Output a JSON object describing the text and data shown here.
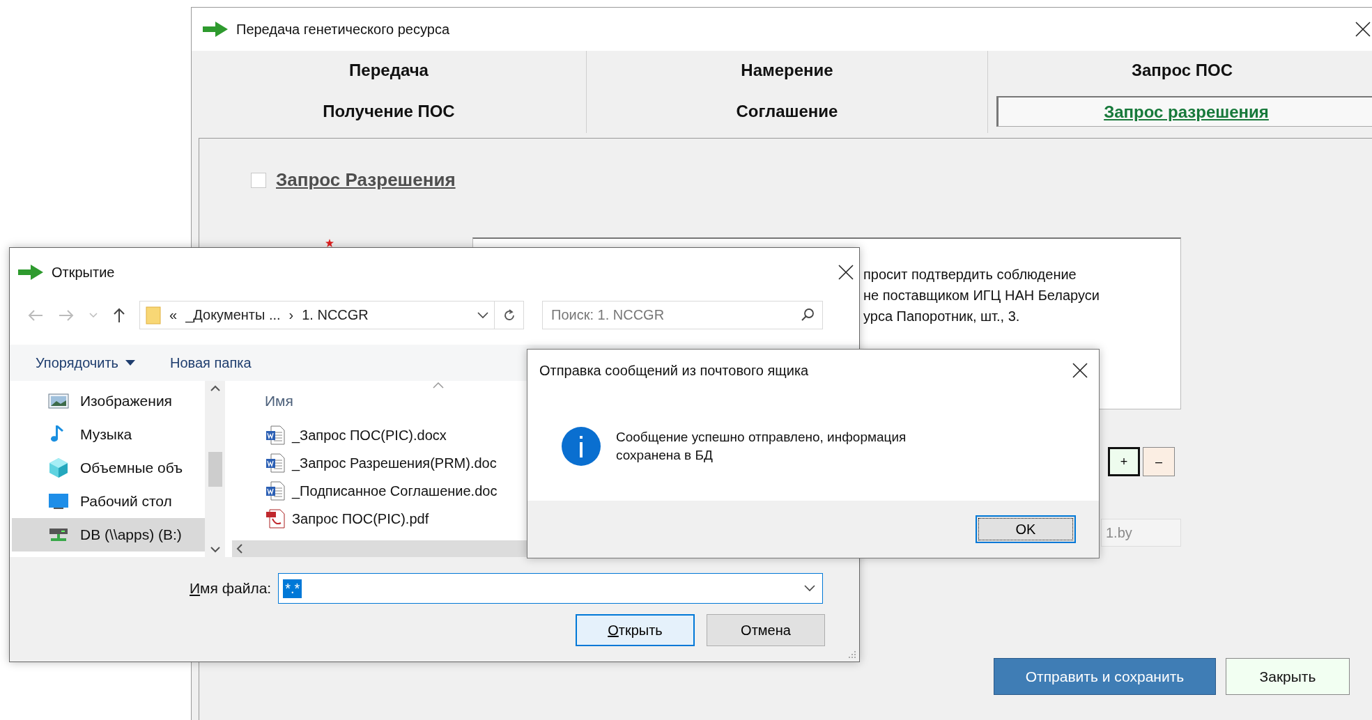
{
  "main_window": {
    "title": "Передача генетического ресурса",
    "tabs": [
      {
        "label": "Передача",
        "selected": false
      },
      {
        "label": "Намерение",
        "selected": false
      },
      {
        "label": "Запрос ПОС",
        "selected": false
      },
      {
        "label": "Получение ПОС",
        "selected": false
      },
      {
        "label": "Соглашение",
        "selected": false
      },
      {
        "label": "Запрос разрешения",
        "selected": true
      }
    ],
    "section": {
      "label": "Запрос Разрешения",
      "checked": false
    },
    "request_text_lines": [
      "просит подтвердить соблюдение",
      "не поставщиком ИГЦ НАН Беларуси",
      "урса Папоротник, шт., 3."
    ],
    "add_button": "+",
    "remove_button": "–",
    "email_field_value": "1.by",
    "buttons": [
      {
        "label": "Отправить и сохранить",
        "kind": "primary"
      },
      {
        "label": "Закрыть",
        "kind": "secondary"
      }
    ]
  },
  "open_dialog": {
    "title": "Открытие",
    "breadcrumbs": {
      "overflow": "«",
      "parent": "_Документы ...",
      "separator": "›",
      "current": "1. NCCGR"
    },
    "search": {
      "placeholder": "Поиск: 1. NCCGR"
    },
    "toolbar": {
      "organize": "Упорядочить",
      "new_folder": "Новая папка"
    },
    "nav_items": [
      {
        "label": "Изображения",
        "kind": "pictures",
        "selected": false
      },
      {
        "label": "Музыка",
        "kind": "music",
        "selected": false
      },
      {
        "label": "Объемные объ",
        "kind": "objects",
        "selected": false
      },
      {
        "label": "Рабочий стол",
        "kind": "desktop",
        "selected": false
      },
      {
        "label": "DB (\\\\apps) (B:)",
        "kind": "drive",
        "selected": true
      }
    ],
    "column_header": "Имя",
    "files": [
      {
        "name": "_Запрос ПОС(PIC).docx",
        "kind": "word"
      },
      {
        "name": "_Запрос Разрешения(PRM).doc",
        "kind": "word"
      },
      {
        "name": "_Подписанное Соглашение.doc",
        "kind": "word"
      },
      {
        "name": "Запрос ПОС(PIC).pdf",
        "kind": "pdf"
      }
    ],
    "filename_label": "Имя файла:",
    "filename_value": "*.*",
    "open_button": "Открыть",
    "cancel_button": "Отмена"
  },
  "message_box": {
    "title": "Отправка сообщений из почтового ящика",
    "message": "Сообщение успешно отправлено, информация сохранена в БД",
    "ok_button": "OK"
  }
}
